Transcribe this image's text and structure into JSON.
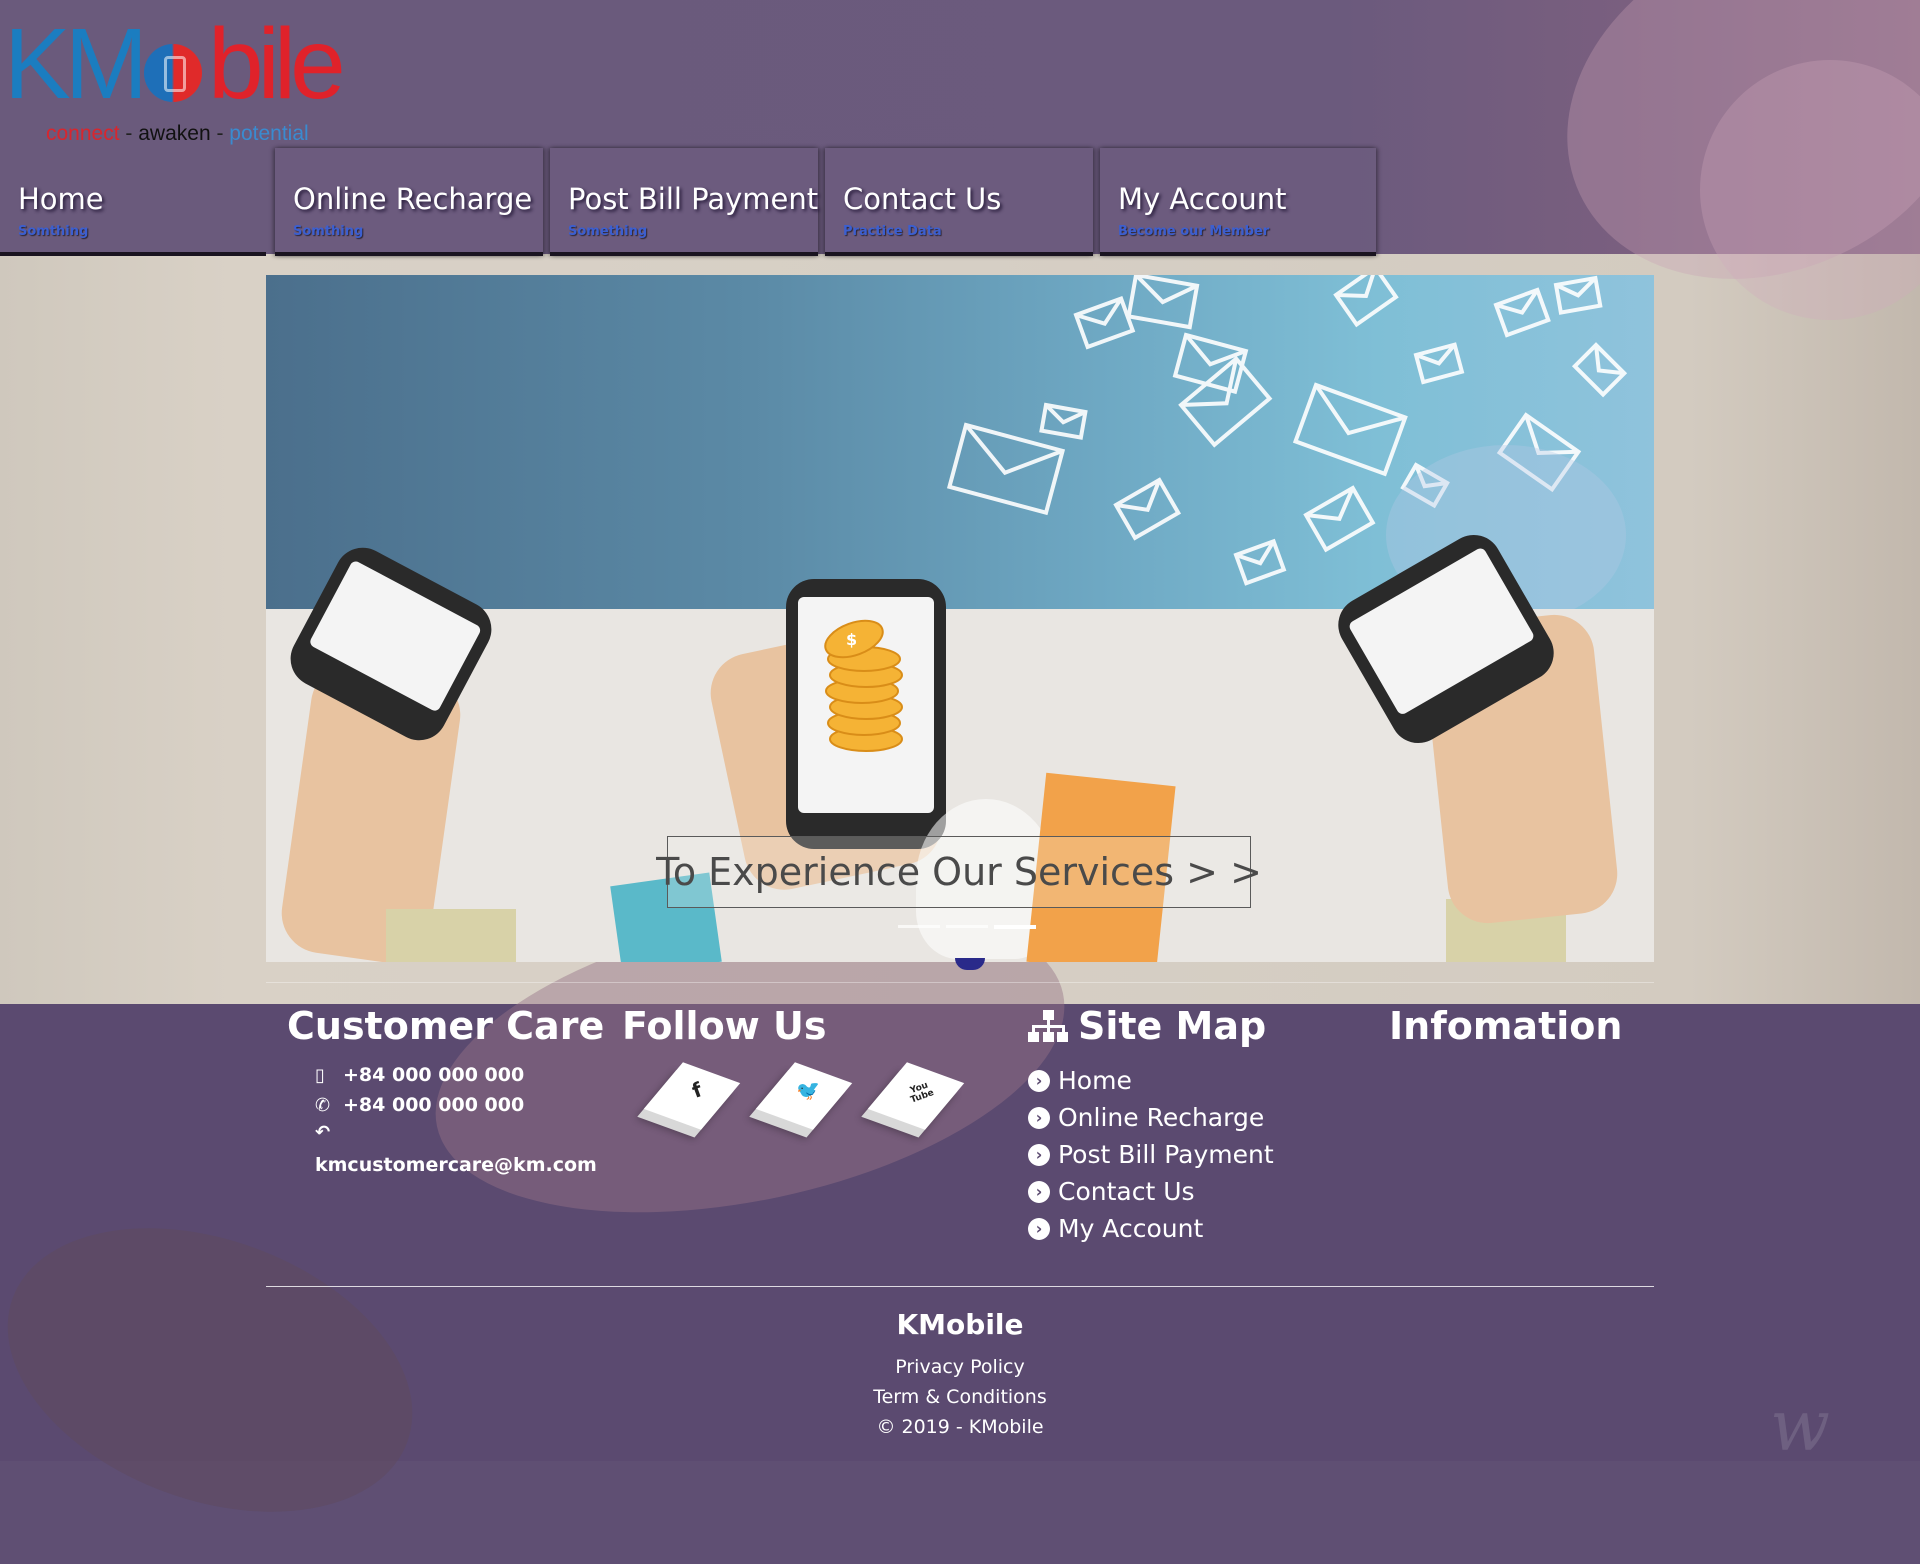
{
  "logo": {
    "k": "K",
    "m": "M",
    "bile": "bile",
    "tag_connect": "connect",
    "tag_sep1": " - ",
    "tag_awaken": "awaken",
    "tag_sep2": " - ",
    "tag_potential": "potential"
  },
  "nav": [
    {
      "label": "Home",
      "sub": "Somthing"
    },
    {
      "label": "Online Recharge",
      "sub": "Somthing"
    },
    {
      "label": "Post Bill Payment",
      "sub": "Something"
    },
    {
      "label": "Contact Us",
      "sub": "Practice Data"
    },
    {
      "label": "My Account",
      "sub": "Become our Member"
    }
  ],
  "hero": {
    "cta": "To Experience Our Services > >",
    "slide_count": 3,
    "active_slide": 2
  },
  "footer": {
    "customer_care": {
      "title": "Customer Care",
      "mobile": "+84 000 000 000",
      "phone": "+84 000 000 000",
      "email": "kmcustomercare@km.com"
    },
    "follow_us": {
      "title": "Follow Us",
      "networks": [
        {
          "name": "facebook",
          "glyph": "f"
        },
        {
          "name": "twitter",
          "glyph": "🐦"
        },
        {
          "name": "youtube",
          "glyph": "You Tube"
        }
      ]
    },
    "site_map": {
      "title": "Site Map",
      "items": [
        "Home",
        "Online Recharge",
        "Post Bill Payment",
        "Contact Us",
        "My Account"
      ]
    },
    "information": {
      "title": "Infomation"
    },
    "brand": "KMobile",
    "privacy": "Privacy Policy",
    "terms": "Term & Conditions",
    "copyright": "© 2019 - KMobile"
  },
  "colors": {
    "purple_bg": "#5b4a70",
    "logo_blue": "#1b7dc0",
    "logo_red": "#e0222a",
    "nav_sub_blue": "#3c5fd0"
  }
}
